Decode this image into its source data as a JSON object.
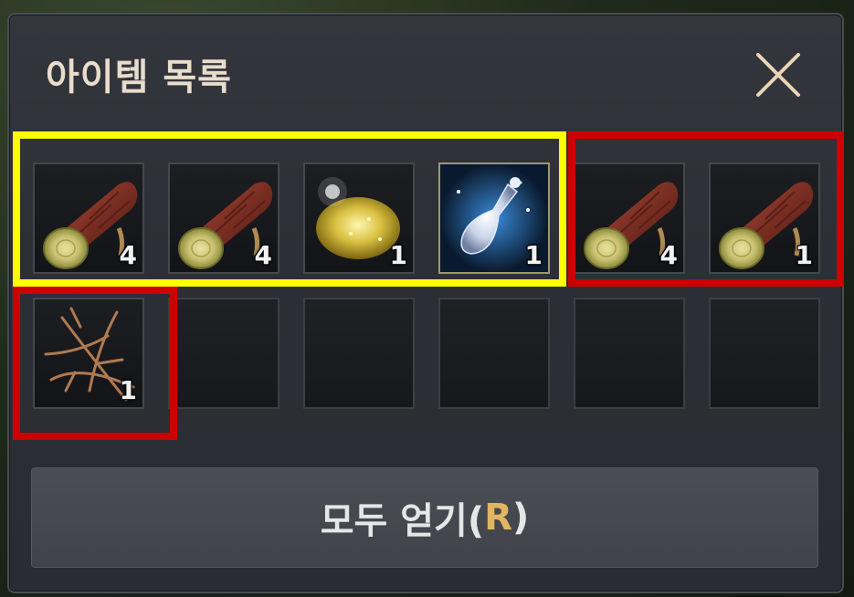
{
  "dialog": {
    "title": "아이템 목록",
    "close_icon": "close-x-icon"
  },
  "items": [
    {
      "name": "log",
      "icon": "log-icon",
      "count": "4"
    },
    {
      "name": "log",
      "icon": "log-icon",
      "count": "4"
    },
    {
      "name": "powder",
      "icon": "powder-icon",
      "count": "1"
    },
    {
      "name": "potion",
      "icon": "potion-icon",
      "count": "1"
    },
    {
      "name": "log",
      "icon": "log-icon",
      "count": "4"
    },
    {
      "name": "log",
      "icon": "log-icon",
      "count": "1"
    },
    {
      "name": "branch",
      "icon": "branch-icon",
      "count": "1"
    },
    {
      "name": "empty"
    },
    {
      "name": "empty"
    },
    {
      "name": "empty"
    },
    {
      "name": "empty"
    },
    {
      "name": "empty"
    }
  ],
  "button": {
    "label_prefix": "모두 얻기(",
    "hotkey": "R",
    "label_suffix": ")"
  },
  "colors": {
    "highlight_yellow": "#ffff00",
    "highlight_red": "#cc0000",
    "hotkey": "#e2b660"
  }
}
